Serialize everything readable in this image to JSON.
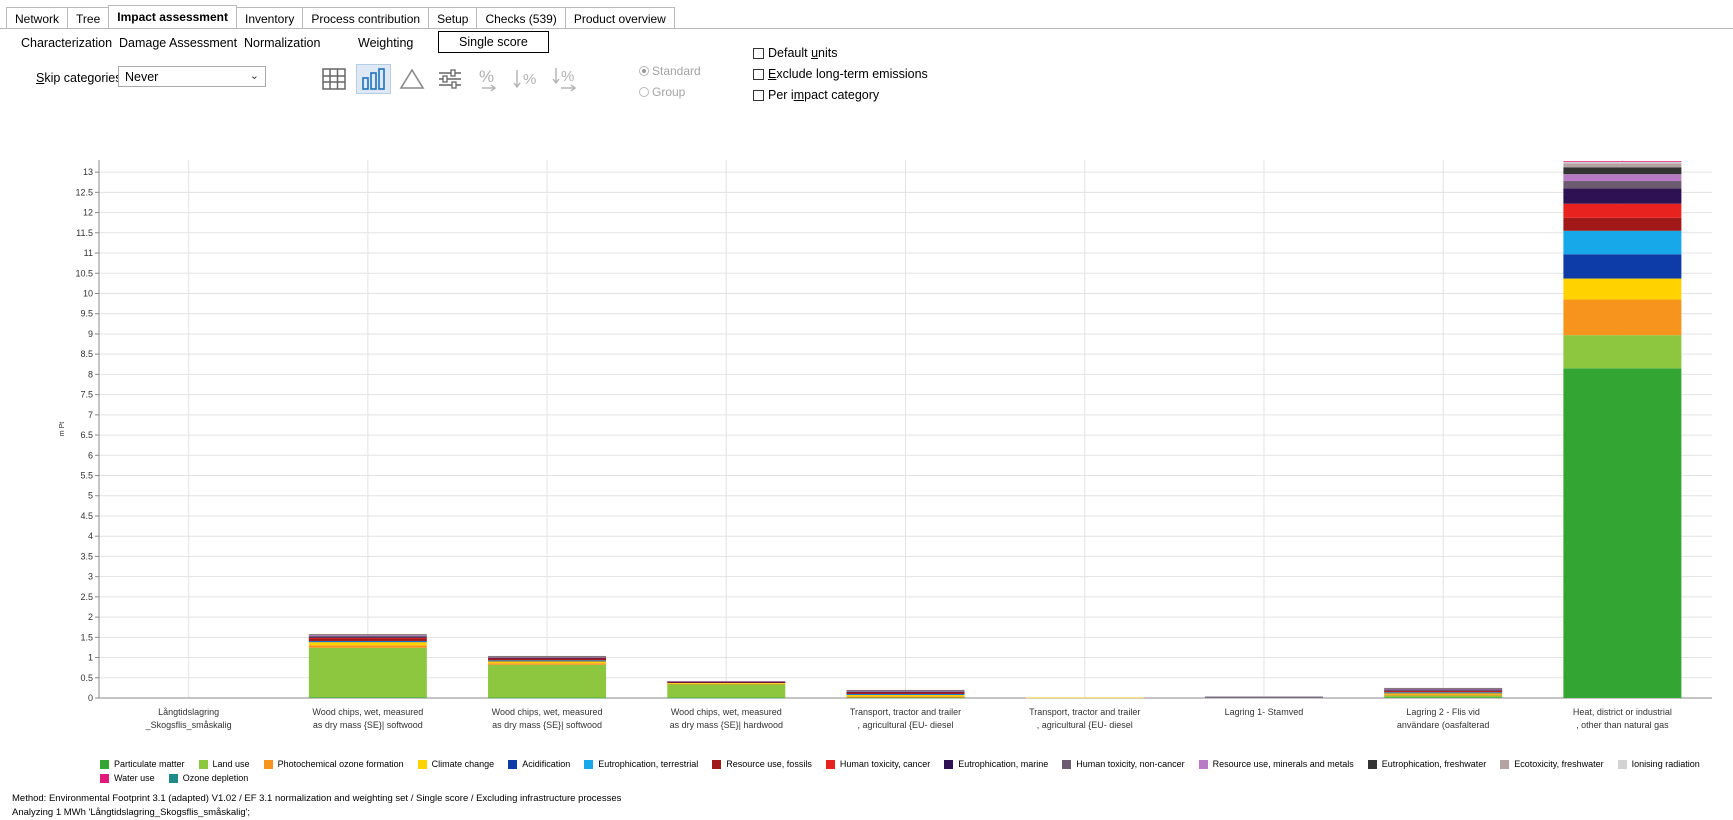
{
  "tabs": [
    {
      "label": "Network",
      "active": false
    },
    {
      "label": "Tree",
      "active": false
    },
    {
      "label": "Impact assessment",
      "active": true
    },
    {
      "label": "Inventory",
      "active": false
    },
    {
      "label": "Process contribution",
      "active": false
    },
    {
      "label": "Setup",
      "active": false
    },
    {
      "label": "Checks (539)",
      "active": false
    },
    {
      "label": "Product overview",
      "active": false
    }
  ],
  "subtabs": {
    "characterization": "Characterization",
    "damage": "Damage Assessment",
    "normalization": "Normalization",
    "weighting": "Weighting",
    "single_score": "Single score"
  },
  "toolbar": {
    "skip_label_prefix": "S",
    "skip_label_rest": "kip categories",
    "skip_value": "Never",
    "radio_standard": "Standard",
    "radio_group": "Group",
    "default_units_prefix": "Default ",
    "default_units_ul": "u",
    "default_units_rest": "nits",
    "exclude_ul": "E",
    "exclude_rest": "xclude long-term emissions",
    "per_impact_prefix": "Per i",
    "per_impact_ul": "m",
    "per_impact_rest": "pact category",
    "icons": [
      "table-icon",
      "bar-chart-icon",
      "triangle-icon",
      "sliders-icon",
      "percent-arrow-icon",
      "sort-percent-down-icon",
      "sort-percent-up-icon"
    ]
  },
  "chart_data": {
    "type": "bar",
    "stacked": true,
    "ylabel": "m Pt",
    "ylim": [
      0,
      13.3
    ],
    "yticks": [
      0,
      0.5,
      1,
      1.5,
      2,
      2.5,
      3,
      3.5,
      4,
      4.5,
      5,
      5.5,
      6,
      6.5,
      7,
      7.5,
      8,
      8.5,
      9,
      9.5,
      10,
      10.5,
      11,
      11.5,
      12,
      12.5,
      13
    ],
    "grid": true,
    "legend_position": "bottom",
    "categories": [
      [
        "Långtidslagring",
        "_Skogsflis_småskalig"
      ],
      [
        "Wood chips, wet, measured",
        "as dry mass {SE}| softwood"
      ],
      [
        "Wood chips, wet, measured",
        "as dry mass {SE}| softwood"
      ],
      [
        "Wood chips, wet, measured",
        "as dry mass {SE}| hardwood"
      ],
      [
        "Transport, tractor and trailer",
        ", agricultural {EU- diesel"
      ],
      [
        "Transport, tractor and trailer",
        ", agricultural {EU- diesel"
      ],
      [
        "Lagring 1- Stamved",
        ""
      ],
      [
        "Lagring 2 - Flis vid",
        "användare (oasfalterad"
      ],
      [
        "Heat, district or industrial",
        ", other than natural gas"
      ]
    ],
    "series": [
      {
        "name": "Particulate matter",
        "color": "#33a532",
        "values": [
          0,
          0.02,
          0.01,
          0.01,
          0.01,
          0.0,
          0.0,
          0.02,
          8.15
        ]
      },
      {
        "name": "Land use",
        "color": "#8dc63f",
        "values": [
          0,
          1.22,
          0.81,
          0.33,
          0.0,
          0.0,
          0.0,
          0.04,
          0.82
        ]
      },
      {
        "name": "Photochemical ozone formation",
        "color": "#f7941d",
        "values": [
          0,
          0.06,
          0.04,
          0.01,
          0.03,
          0.0,
          0.0,
          0.03,
          0.88
        ]
      },
      {
        "name": "Climate change",
        "color": "#ffd200",
        "values": [
          0,
          0.08,
          0.05,
          0.02,
          0.04,
          0.01,
          0.0,
          0.03,
          0.52
        ]
      },
      {
        "name": "Acidification",
        "color": "#0d3ca8",
        "values": [
          0,
          0.02,
          0.01,
          0.0,
          0.01,
          0.0,
          0.0,
          0.01,
          0.6
        ]
      },
      {
        "name": "Eutrophication, terrestrial",
        "color": "#16a8e8",
        "values": [
          0,
          0.01,
          0.01,
          0.0,
          0.01,
          0.0,
          0.0,
          0.01,
          0.58
        ]
      },
      {
        "name": "Resource use, fossils",
        "color": "#a01818",
        "values": [
          0,
          0.06,
          0.04,
          0.02,
          0.03,
          0.0,
          0.0,
          0.03,
          0.32
        ]
      },
      {
        "name": "Human toxicity, cancer",
        "color": "#e8231f",
        "values": [
          0,
          0.02,
          0.01,
          0.0,
          0.01,
          0.0,
          0.0,
          0.01,
          0.35
        ]
      },
      {
        "name": "Eutrophication, marine",
        "color": "#2e1152",
        "values": [
          0,
          0.02,
          0.01,
          0.01,
          0.01,
          0.0,
          0.0,
          0.01,
          0.38
        ]
      },
      {
        "name": "Human toxicity, non-cancer",
        "color": "#6b5a70",
        "values": [
          0,
          0.03,
          0.02,
          0.01,
          0.02,
          0.0,
          0.0,
          0.02,
          0.18
        ]
      },
      {
        "name": "Resource use, minerals and metals",
        "color": "#b87bc4",
        "values": [
          0,
          0.02,
          0.01,
          0.01,
          0.01,
          0.0,
          0.0,
          0.02,
          0.17
        ]
      },
      {
        "name": "Eutrophication, freshwater",
        "color": "#333333",
        "values": [
          0,
          0.01,
          0.01,
          0.0,
          0.01,
          0.0,
          0.0,
          0.01,
          0.17
        ]
      },
      {
        "name": "Ecotoxicity, freshwater",
        "color": "#b5a3a3",
        "values": [
          0,
          0.01,
          0.01,
          0.0,
          0.01,
          0.0,
          0.0,
          0.01,
          0.1
        ]
      },
      {
        "name": "Ionising radiation",
        "color": "#d3d3d3",
        "values": [
          0,
          0.0,
          0.0,
          0.0,
          0.0,
          0.0,
          0.0,
          0.0,
          0.03
        ]
      },
      {
        "name": "Water use",
        "color": "#e0197a",
        "values": [
          0,
          0.0,
          0.0,
          0.0,
          0.0,
          0.0,
          0.0,
          0.0,
          0.02
        ]
      },
      {
        "name": "Ozone depletion",
        "color": "#1f8a8a",
        "values": [
          0,
          0.0,
          0.0,
          0.0,
          0.0,
          0.0,
          0.0,
          0.0,
          0.0
        ]
      }
    ]
  },
  "footer": {
    "method": "Method: Environmental Footprint 3.1 (adapted) V1.02 / EF 3.1 normalization and weighting set / Single score / Excluding infrastructure processes",
    "analyzing": "Analyzing 1 MWh 'Långtidslagring_Skogsflis_småskalig';"
  }
}
